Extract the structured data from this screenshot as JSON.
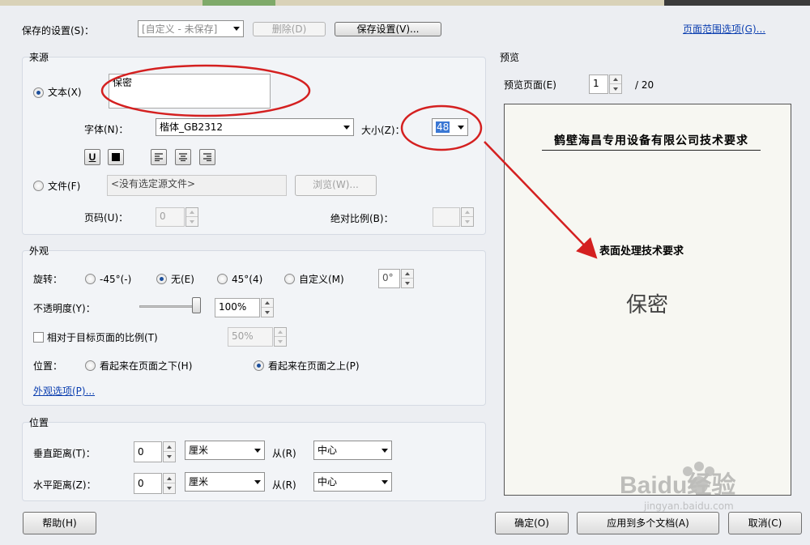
{
  "saved_settings": {
    "label": "保存的设置(S)：",
    "combo_value": "[自定义 - 未保存]",
    "delete_button": "删除(D)",
    "save_button": "保存设置(V)..."
  },
  "page_range_link": "页面范围选项(G)...",
  "source": {
    "title": "来源",
    "text_radio": "文本(X)",
    "text_value": "保密",
    "font_label": "字体(N)：",
    "font_value": "楷体_GB2312",
    "size_label": "大小(Z)：",
    "size_value": "48",
    "file_radio": "文件(F)",
    "file_placeholder": "<没有选定源文件>",
    "browse_button": "浏览(W)...",
    "page_label": "页码(U)：",
    "page_value": "0",
    "absolute_scale_label": "绝对比例(B)："
  },
  "appearance": {
    "title": "外观",
    "rotation_label": "旋转：",
    "rotation_options": [
      "-45°(-)",
      "无(E)",
      "45°(4)",
      "自定义(M)"
    ],
    "rotation_selected": "无(E)",
    "rotation_custom_value": "0°",
    "opacity_label": "不透明度(Y)：",
    "opacity_value": "100%",
    "opacity_level": 1.0,
    "relative_scale_label": "相对于目标页面的比例(T)",
    "relative_scale_value": "50%",
    "position_label": "位置：",
    "position_options": [
      "看起来在页面之下(H)",
      "看起来在页面之上(P)"
    ],
    "position_selected": "看起来在页面之上(P)",
    "options_link": "外观选项(P)..."
  },
  "location": {
    "title": "位置",
    "vertical_label": "垂直距离(T)：",
    "vertical_value": "0",
    "vertical_unit": "厘米",
    "vertical_from_label": "从(R)",
    "vertical_from_value": "中心",
    "horizontal_label": "水平距离(Z)：",
    "horizontal_value": "0",
    "horizontal_unit": "厘米",
    "horizontal_from_label": "从(R)",
    "horizontal_from_value": "中心"
  },
  "preview": {
    "title": "预览",
    "page_label": "预览页面(E)",
    "page_value": "1",
    "page_total": "/ 20",
    "doc_heading": "鹤壁海昌专用设备有限公司技术要求",
    "doc_subheading": "表面处理技术要求",
    "watermark_text": "保密"
  },
  "footer": {
    "help_button": "帮助(H)",
    "ok_button": "确定(O)",
    "apply_multiple_button": "应用到多个文档(A)",
    "cancel_button": "取消(C)"
  },
  "overlay": {
    "logo_text": "Baidu经验",
    "logo_url": "jingyan.baidu.com"
  },
  "colors": {
    "annotation_red": "#d42020",
    "link_blue": "#0c3fb0",
    "selection_blue": "#3a77d4"
  }
}
